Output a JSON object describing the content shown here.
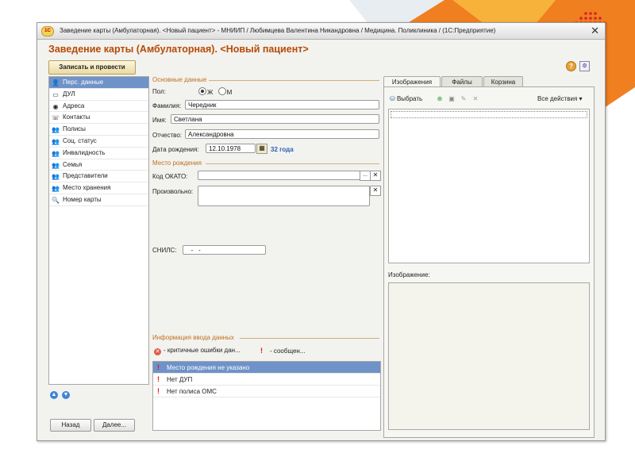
{
  "window": {
    "title": "Заведение карты (Амбулаторная). <Новый пациент> - МНИИП / Любимцева Валентина Никандровна / Медицина. Поликлиника / (1С:Предприятие)",
    "close_label": "✕",
    "logo_label": "1С"
  },
  "form": {
    "title": "Заведение карты (Амбулаторная). <Новый пациент>",
    "save_button": "Записать и провести",
    "help_icon": "?",
    "settings_icon": "⚙"
  },
  "sidebar": {
    "items": [
      {
        "label": "Перс. данные",
        "icon": "person-icon",
        "glyph": "👤",
        "selected": true
      },
      {
        "label": "ДУЛ",
        "icon": "document-icon",
        "glyph": "▭"
      },
      {
        "label": "Адреса",
        "icon": "globe-icon",
        "glyph": "◉"
      },
      {
        "label": "Контакты",
        "icon": "phone-icon",
        "glyph": "☏"
      },
      {
        "label": "Полисы",
        "icon": "people-icon",
        "glyph": "👥"
      },
      {
        "label": "Соц. статус",
        "icon": "people-icon",
        "glyph": "👥"
      },
      {
        "label": "Инвалидность",
        "icon": "people-icon",
        "glyph": "👥"
      },
      {
        "label": "Семья",
        "icon": "people-icon",
        "glyph": "👥"
      },
      {
        "label": "Представители",
        "icon": "people-icon",
        "glyph": "👥"
      },
      {
        "label": "Место хранения",
        "icon": "people-icon",
        "glyph": "👥"
      },
      {
        "label": "Номер карты",
        "icon": "search-card-icon",
        "glyph": "🔍"
      }
    ],
    "up_arrow": "▲",
    "down_arrow": "▼"
  },
  "nav": {
    "back_label": "Назад",
    "next_label": "Далее..."
  },
  "basic": {
    "group_title": "Основные данные",
    "gender_label": "Пол:",
    "gender_f": "Ж",
    "gender_m": "М",
    "gender_selected": "Ж",
    "surname_label": "Фамилия:",
    "surname_value": "Чередник",
    "name_label": "Имя:",
    "name_value": "Светлана",
    "patronymic_label": "Отчество:",
    "patronymic_value": "Александровна",
    "birthdate_label": "Дата рождения:",
    "birthdate_value": "12.10.1978",
    "age_text": "32 года"
  },
  "birthplace": {
    "group_title": "Место рождения",
    "okato_label": "Код ОКАТО:",
    "okato_value": "",
    "free_label": "Произвольно:",
    "free_value": "",
    "choose_btn": "...",
    "clear_btn": "✕"
  },
  "snils": {
    "label": "СНИЛС:",
    "value": "   -   -"
  },
  "info": {
    "group_title": "Информация ввода данных",
    "critical_filter": "- критичные ошибки дан...",
    "messages_filter": "- сообщен...",
    "rows": [
      {
        "text": "Место рождения не указано",
        "selected": true
      },
      {
        "text": "Нет ДУП"
      },
      {
        "text": "Нет полиса ОМС"
      }
    ]
  },
  "right": {
    "tabs": [
      "Изображения",
      "Файлы",
      "Корзина"
    ],
    "active_tab": "Изображения",
    "toolbar": {
      "choose_label": "Выбрать",
      "all_actions": "Все действия ▾"
    },
    "image_label": "Изображение:"
  },
  "colors": {
    "title_accent": "#b84a06",
    "selection": "#6f92c8",
    "error_red": "#d21a1a",
    "age_blue": "#2a5fb4"
  }
}
